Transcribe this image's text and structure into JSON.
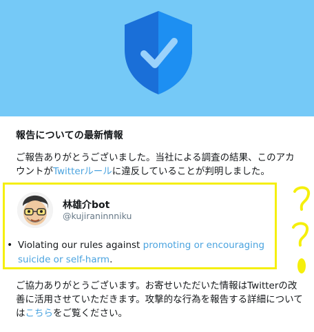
{
  "report": {
    "title": "報告についての最新情報",
    "intro_before": "ご報告ありがとうございました。当社による調査の結果、このアカウントが",
    "intro_link": "Twitterルール",
    "intro_after": "に違反していることが判明しました。",
    "account": {
      "name": "林雄介bot",
      "handle": "@kujiraninnniku"
    },
    "violation": {
      "prefix": "Violating our rules against ",
      "link": "promoting or encouraging suicide or self-harm",
      "suffix": "."
    },
    "outro_before": "ご協力ありがとうございます。お寄せいただいた情報はTwitterの改善に活用させていただきます。攻撃的な行為を報告する詳細については",
    "outro_link": "こちら",
    "outro_after": "をご覧ください。"
  },
  "colors": {
    "hero": "#75c9f7",
    "shield_dark": "#1a6fd8",
    "shield_light": "#1d8ff2",
    "check": "#9bd2fb",
    "link": "#4aa3df",
    "highlight": "#f5ef0c"
  },
  "icons": {
    "shield": "shield-check-icon",
    "annotation": "question-mark-scribble"
  }
}
